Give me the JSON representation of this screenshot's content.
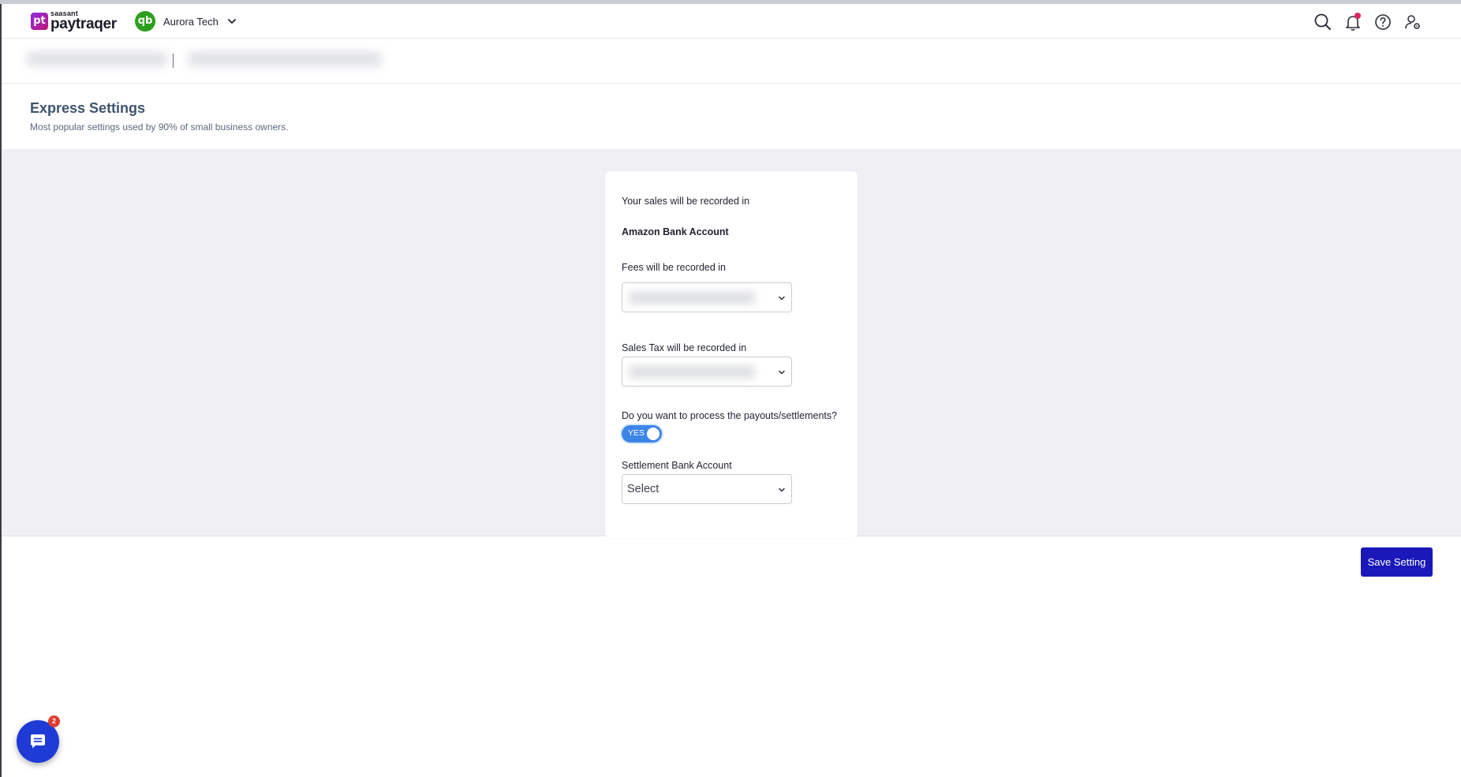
{
  "header": {
    "logo_small": "saasant",
    "logo_big": "paytraqer",
    "logo_mark": "pt",
    "qb_mark": "qb",
    "company_name": "Aurora Tech",
    "icons": [
      "search-icon",
      "bell-icon",
      "help-icon",
      "user-settings-icon"
    ]
  },
  "page": {
    "title": "Express Settings",
    "subtitle": "Most popular settings used by 90% of small business owners."
  },
  "card": {
    "sales_label": "Your sales will be recorded in",
    "sales_account": "Amazon Bank Account",
    "fees_label": "Fees will be recorded in",
    "sales_tax_label": "Sales Tax will be recorded in",
    "payout_question": "Do you want to process the payouts/settlements?",
    "payout_toggle": "YES",
    "settlement_label": "Settlement Bank Account",
    "settlement_value": "Select"
  },
  "actions": {
    "save_label": "Save Setting"
  },
  "chat": {
    "badge_count": "2"
  },
  "colors": {
    "brand_primary": "#1a18b8",
    "toggle_on": "#3d86e8",
    "notification_dot": "#e0245e",
    "qb_green": "#2ca01c",
    "title_color": "#3e5470"
  }
}
